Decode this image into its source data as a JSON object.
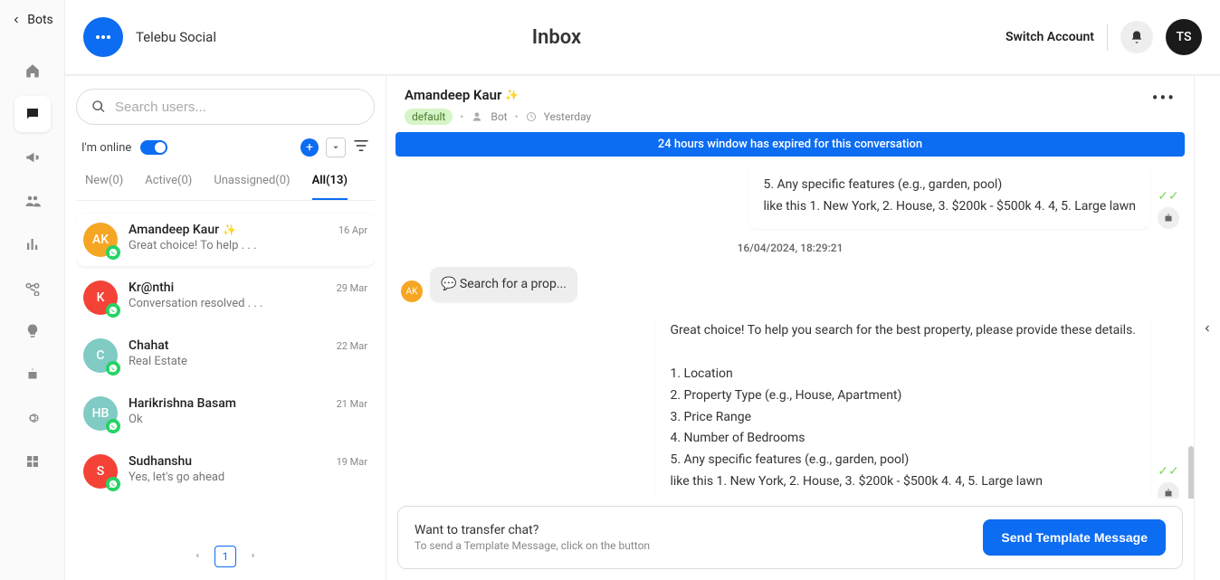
{
  "back": {
    "label": "Bots"
  },
  "brand": {
    "name": "Telebu Social"
  },
  "page_title": "Inbox",
  "top_actions": {
    "switch": "Switch Account",
    "avatar": "TS"
  },
  "search": {
    "placeholder": "Search users..."
  },
  "status": {
    "online_label": "I'm online"
  },
  "tabs": {
    "new": "New(0)",
    "active": "Active(0)",
    "unassigned": "Unassigned(0)",
    "all": "All(13)"
  },
  "conversations": [
    {
      "initials": "AK",
      "color": "#f5a623",
      "name": "Amandeep Kaur",
      "sparkle": "✨",
      "date": "16 Apr",
      "preview": "Great choice! To help . . .",
      "active": true
    },
    {
      "initials": "K",
      "color": "#f44336",
      "name": "Kr@nthi",
      "sparkle": "",
      "date": "29 Mar",
      "preview": "Conversation resolved . . .",
      "active": false
    },
    {
      "initials": "C",
      "color": "#80cbc4",
      "name": "Chahat",
      "sparkle": "",
      "date": "22 Mar",
      "preview": "Real Estate",
      "active": false
    },
    {
      "initials": "HB",
      "color": "#80cbc4",
      "name": "Harikrishna Basam",
      "sparkle": "",
      "date": "21 Mar",
      "preview": "Ok",
      "active": false
    },
    {
      "initials": "S",
      "color": "#f44336",
      "name": "Sudhanshu",
      "sparkle": "",
      "date": "19 Mar",
      "preview": "Yes, let's go ahead",
      "active": false
    }
  ],
  "pager": {
    "current": "1"
  },
  "chat": {
    "name": "Amandeep Kaur",
    "sparkle": "✨",
    "badge": "default",
    "agent": "Bot",
    "time": "Yesterday",
    "banner": "24 hours window has expired for this conversation",
    "msg_top_lines": "5. Any specific features (e.g., garden, pool)\nlike this 1. New York, 2. House, 3. $200k - $500k 4. 4, 5. Large lawn",
    "divider_time": "16/04/2024, 18:29:21",
    "msg_in": "Search for a prop...",
    "msg_main": "Great choice! To help you search for the best property, please provide these details.\n\n1. Location\n2. Property Type (e.g., House, Apartment)\n3. Price Range\n4. Number of Bedrooms\n5. Any specific features (e.g., garden, pool)\nlike this 1. New York, 2. House, 3. $200k - $500k 4. 4, 5. Large lawn",
    "footer_title": "Want to transfer chat?",
    "footer_sub": "To send a Template Message, click on the button",
    "send_label": "Send Template Message",
    "in_avatar": "AK"
  }
}
